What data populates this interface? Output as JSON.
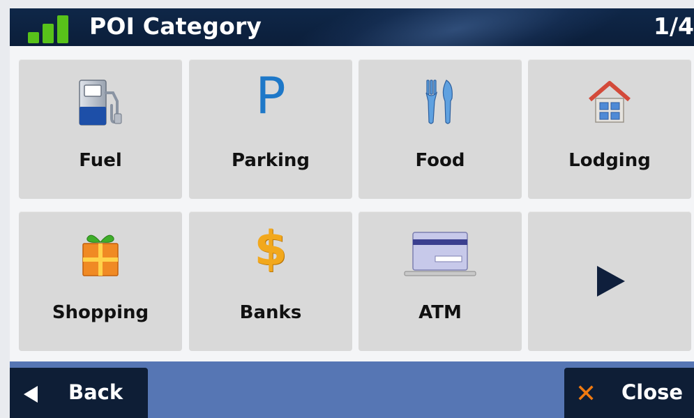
{
  "header": {
    "title": "POI Category",
    "page": "1/4"
  },
  "categories": [
    {
      "label": "Fuel",
      "icon": "fuel-pump-icon"
    },
    {
      "label": "Parking",
      "icon": "parking-icon"
    },
    {
      "label": "Food",
      "icon": "fork-knife-icon"
    },
    {
      "label": "Lodging",
      "icon": "house-icon"
    },
    {
      "label": "Shopping",
      "icon": "gift-icon"
    },
    {
      "label": "Banks",
      "icon": "dollar-icon"
    },
    {
      "label": "ATM",
      "icon": "atm-card-icon"
    }
  ],
  "next": {
    "icon": "play-right-icon"
  },
  "footer": {
    "back_label": "Back",
    "close_label": "Close"
  },
  "colors": {
    "header_bg": "#0b1e3a",
    "tile_bg": "#d9d9d9",
    "footer_bg": "#5676b4",
    "button_bg": "#0e1e36",
    "signal_green": "#58c21a",
    "close_orange": "#f07a10"
  }
}
